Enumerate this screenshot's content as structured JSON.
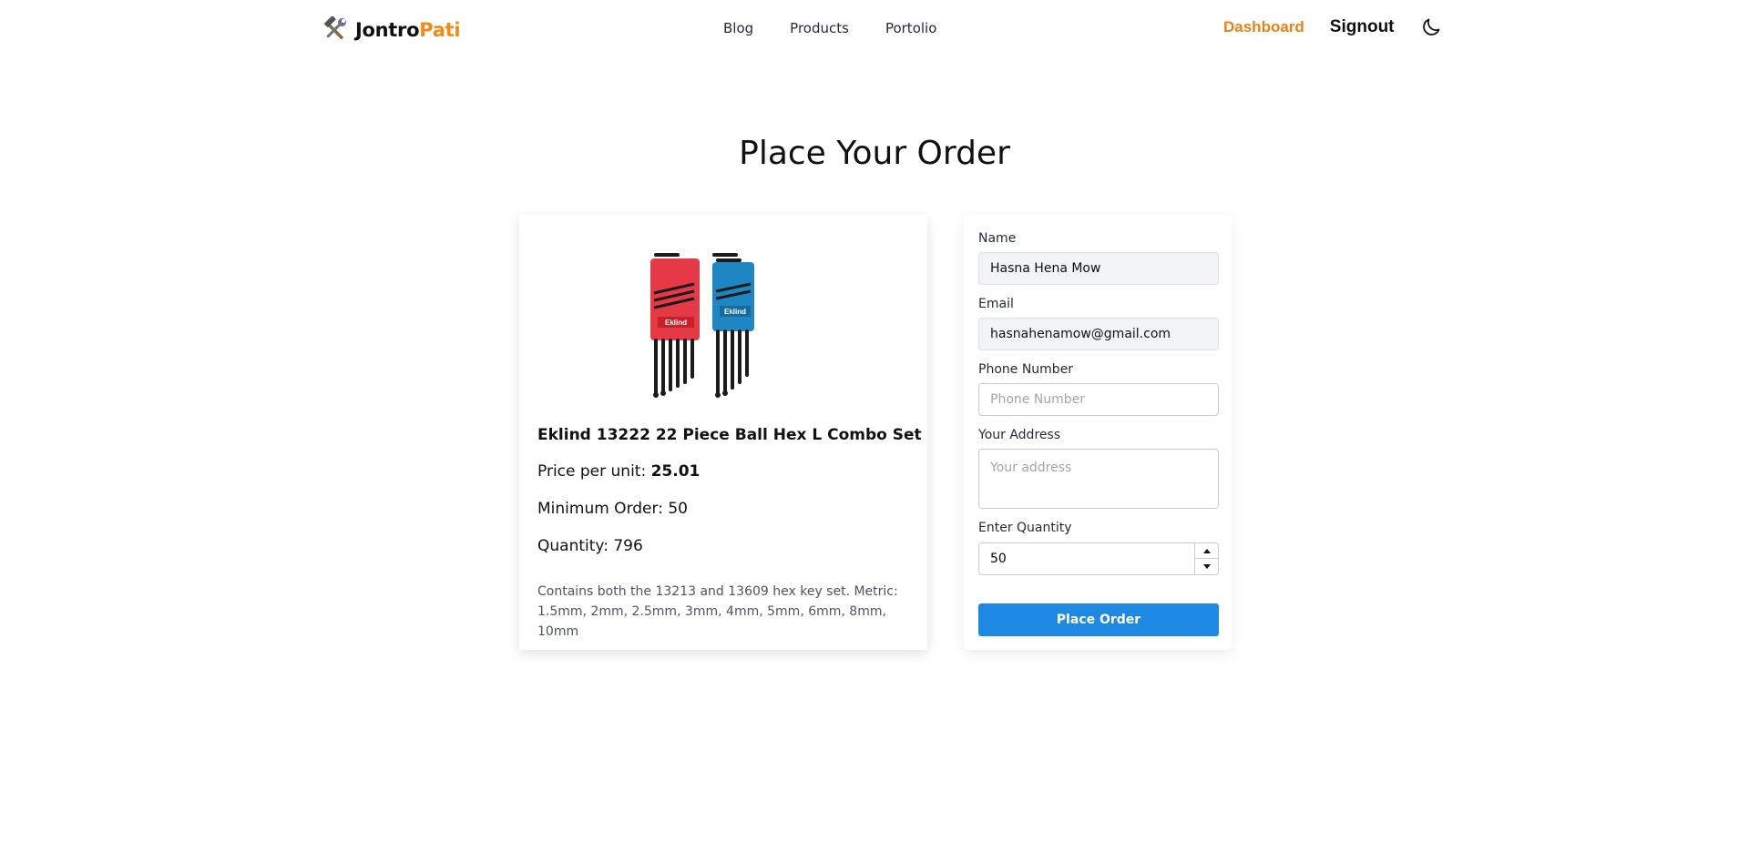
{
  "nav": {
    "brand_prefix": "Jontro",
    "brand_accent": "Pati",
    "brand_icon": "tools-icon",
    "links": [
      "Blog",
      "Products",
      "Portolio"
    ],
    "dashboard": "Dashboard",
    "signout": "Signout",
    "theme_icon": "moon-icon"
  },
  "page": {
    "title": "Place Your Order"
  },
  "product": {
    "image_icon": "hex-key-set-image",
    "name": "Eklind 13222 22 Piece Ball Hex L Combo Set",
    "price_label": "Price per unit: ",
    "price_value": "25.01",
    "min_order": "Minimum Order: 50",
    "quantity": "Quantity: 796",
    "description": "Contains both the 13213 and 13609 hex key set. Metric: 1.5mm, 2mm, 2.5mm, 3mm, 4mm, 5mm, 6mm, 8mm, 10mm",
    "image_brand_text": "Eklind"
  },
  "form": {
    "name_label": "Name",
    "name_value": "Hasna Hena Mow",
    "email_label": "Email",
    "email_value": "hasnahenamow@gmail.com",
    "phone_label": "Phone Number",
    "phone_placeholder": "Phone Number",
    "address_label": "Your Address",
    "address_placeholder": "Your address",
    "quantity_label": "Enter Quantity",
    "quantity_value": "50",
    "submit_label": "Place Order"
  },
  "colors": {
    "accent_orange": "#f28a15",
    "primary_blue": "#1e88e5"
  }
}
